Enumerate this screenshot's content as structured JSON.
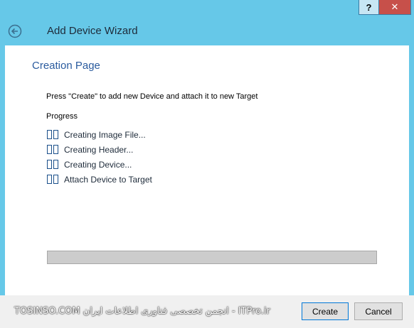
{
  "window": {
    "help_label": "?",
    "close_label": "✕",
    "title": "Add Device Wizard"
  },
  "page": {
    "title": "Creation Page",
    "instruction": "Press \"Create\" to add new Device and attach it to new Target",
    "progress_label": "Progress"
  },
  "steps": [
    {
      "label": "Creating Image File..."
    },
    {
      "label": "Creating Header..."
    },
    {
      "label": "Creating Device..."
    },
    {
      "label": "Attach Device to Target"
    }
  ],
  "progress": {
    "fraction": 0
  },
  "footer": {
    "watermark": "TOSINSO.COM انجمن تخصصی فناوری اطلاعات ایران - ITPro.ir",
    "create_label": "Create",
    "cancel_label": "Cancel"
  },
  "colors": {
    "window_chrome": "#66c8e8",
    "page_title": "#2a5b9e",
    "close_button": "#c7504a"
  }
}
